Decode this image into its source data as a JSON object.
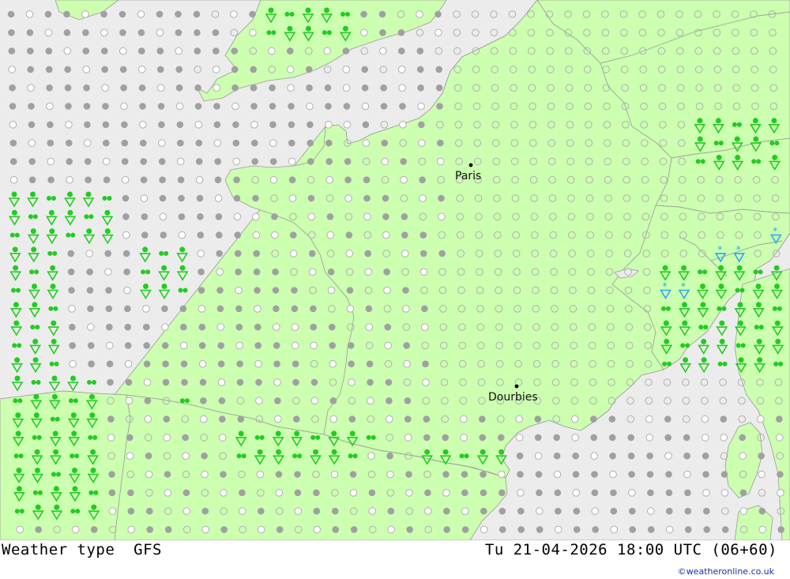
{
  "map": {
    "land_color": "#ccffb0",
    "sea_color": "#ececec",
    "border_color": "#a0a0a0",
    "symbol_colors": {
      "overcast": "#a0a0a0",
      "clear_outline": "#b0b0b0",
      "rain": "#22cc22",
      "snow": "#2aa8ee"
    },
    "cities": [
      {
        "name": "Paris"
      },
      {
        "name": "Dourbies"
      }
    ],
    "symbols_legend": [
      "overcast-icon",
      "clear-sky-icon",
      "partly-cloudy-icon",
      "light-rain-icon",
      "rain-shower-icon",
      "snow-shower-icon"
    ]
  },
  "footer": {
    "left": "Weather type  GFS",
    "right": "Tu 21-04-2026 18:00 UTC (06+60)",
    "credit": "©weatheronline.co.uk"
  }
}
